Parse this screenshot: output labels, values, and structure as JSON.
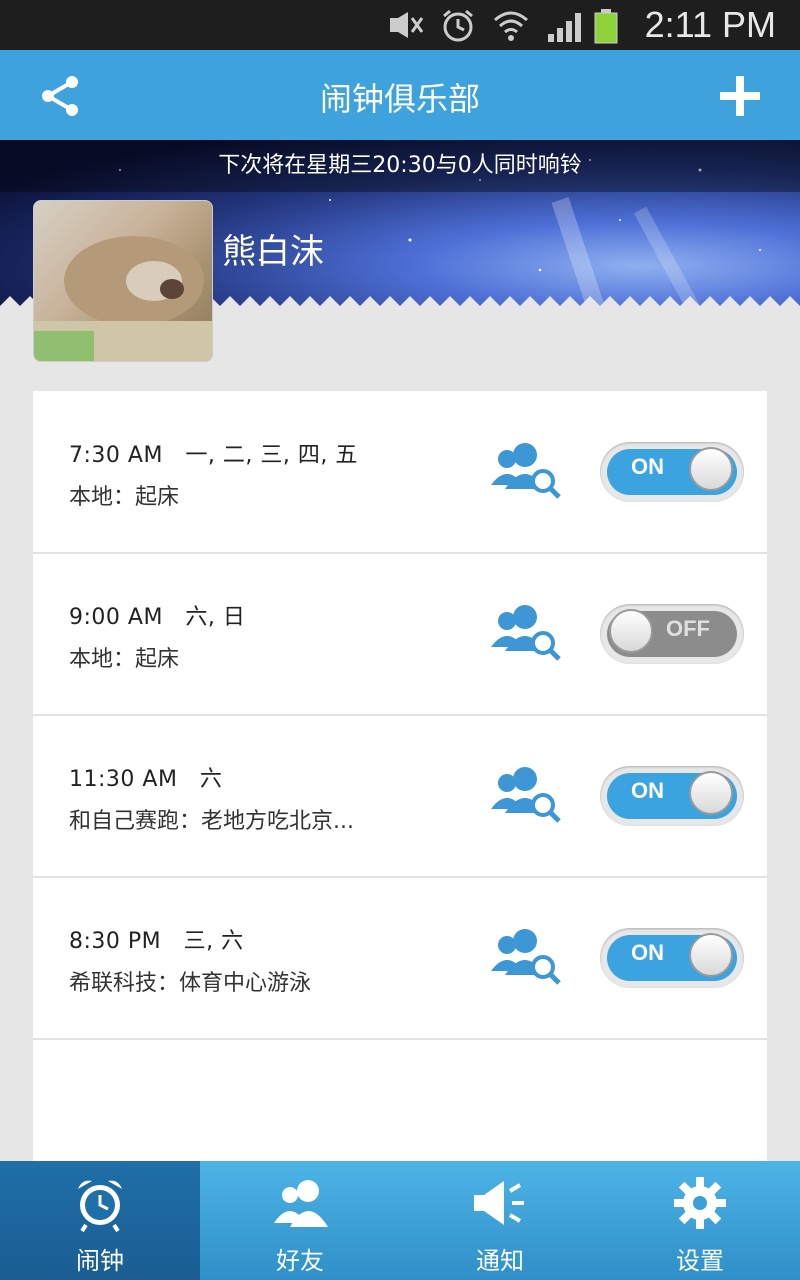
{
  "status_bar": {
    "time": "2:11 PM"
  },
  "app_bar": {
    "title": "闹钟俱乐部"
  },
  "banner": {
    "notice": "下次将在星期三20:30与0人同时响铃",
    "user_name": "熊白沫"
  },
  "alarms": [
    {
      "time": "7:30  AM",
      "days": "一, 二, 三, 四, 五",
      "desc": "本地：起床",
      "state": "ON"
    },
    {
      "time": "9:00  AM",
      "days": "六, 日",
      "desc": "本地：起床",
      "state": "OFF"
    },
    {
      "time": "11:30  AM",
      "days": "六",
      "desc": "和自己赛跑：老地方吃北京...",
      "state": "ON"
    },
    {
      "time": "8:30  PM",
      "days": "三, 六",
      "desc": "希联科技：体育中心游泳",
      "state": "ON"
    }
  ],
  "tabs": [
    {
      "label": "闹钟",
      "icon": "alarm-clock-icon"
    },
    {
      "label": "好友",
      "icon": "friends-icon"
    },
    {
      "label": "通知",
      "icon": "megaphone-icon"
    },
    {
      "label": "设置",
      "icon": "gear-icon"
    }
  ],
  "colors": {
    "accent": "#3ea3dd",
    "toggle_on": "#3aa3e0",
    "toggle_off": "#8c8c8c"
  }
}
